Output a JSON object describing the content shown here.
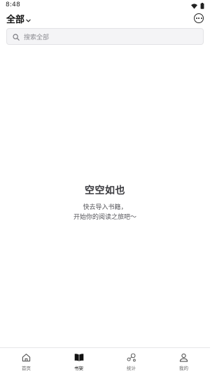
{
  "status_bar": {
    "time": "8:48",
    "icons": [
      "wifi-icon",
      "battery-icon"
    ]
  },
  "header": {
    "filter_label": "全部",
    "filter_icon": "chevron-down-icon",
    "more_icon": "more-horizontal-circle-icon"
  },
  "search": {
    "placeholder": "搜索全部",
    "icon": "search-icon"
  },
  "empty_state": {
    "title": "空空如也",
    "line1": "快去导入书籍，",
    "line2": "开始你的阅读之旅吧～"
  },
  "bottom_nav": {
    "items": [
      {
        "label": "首页",
        "icon": "home-icon",
        "active": false
      },
      {
        "label": "书架",
        "icon": "book-open-icon",
        "active": true
      },
      {
        "label": "统计",
        "icon": "stats-icon",
        "active": false
      },
      {
        "label": "我的",
        "icon": "user-icon",
        "active": false
      }
    ]
  },
  "colors": {
    "background": "#ffffff",
    "search_bg": "#f4f4f6",
    "text_primary": "#111111",
    "text_secondary": "#55555a",
    "placeholder": "#8c8c92"
  }
}
